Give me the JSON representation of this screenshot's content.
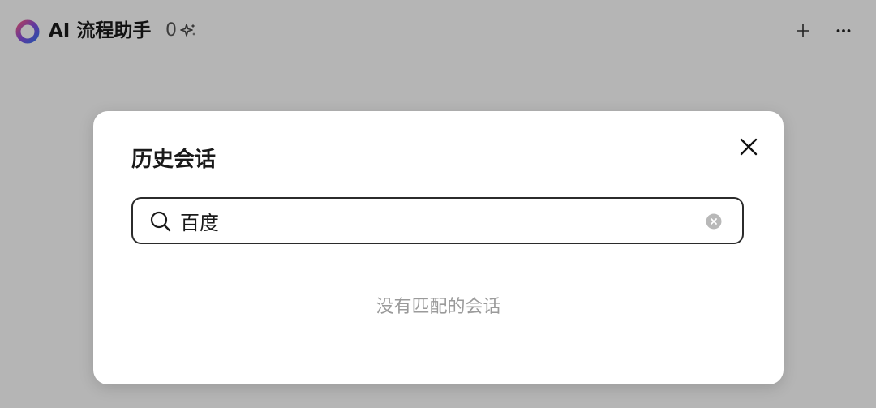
{
  "header": {
    "title": "AI 流程助手",
    "credit_count": "0",
    "logo_icon": "ring-logo-icon",
    "sparkle_icon": "sparkle-icon",
    "add_icon": "plus-icon",
    "more_icon": "more-dots-icon"
  },
  "modal": {
    "title": "历史会话",
    "close_icon": "close-icon",
    "search": {
      "value": "百度",
      "icon": "search-icon",
      "clear_icon": "clear-circle-icon"
    },
    "empty_text": "没有匹配的会话"
  },
  "colors": {
    "overlay": "#b3b3b3",
    "modal_bg": "#ffffff",
    "text_primary": "#1a1a1a",
    "text_muted": "#9a9a9a",
    "logo_gradient": [
      "#e84a9b",
      "#7a4be0",
      "#3a6ff0"
    ]
  }
}
